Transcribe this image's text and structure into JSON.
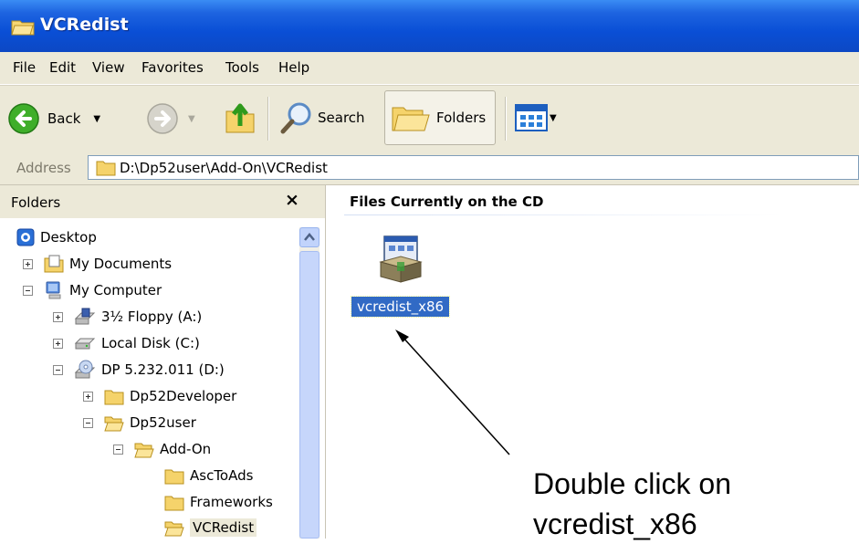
{
  "window": {
    "title": "VCRedist"
  },
  "menu": [
    {
      "label": "File"
    },
    {
      "label": "Edit"
    },
    {
      "label": "View"
    },
    {
      "label": "Favorites"
    },
    {
      "label": "Tools"
    },
    {
      "label": "Help"
    }
  ],
  "toolbar": {
    "back_label": "Back",
    "search_label": "Search",
    "folders_label": "Folders"
  },
  "address": {
    "label": "Address",
    "value": "D:\\Dp52user\\Add-On\\VCRedist"
  },
  "folders_pane": {
    "title": "Folders",
    "close": "×",
    "tree": [
      {
        "label": "Desktop"
      },
      {
        "label": "My Documents"
      },
      {
        "label": "My Computer"
      },
      {
        "label": "3½ Floppy (A:)"
      },
      {
        "label": "Local Disk (C:)"
      },
      {
        "label": "DP 5.232.011 (D:)"
      },
      {
        "label": "Dp52Developer"
      },
      {
        "label": "Dp52user"
      },
      {
        "label": "Add-On"
      },
      {
        "label": "AscToAds"
      },
      {
        "label": "Frameworks"
      },
      {
        "label": "VCRedist"
      }
    ]
  },
  "content": {
    "header": "Files Currently on the CD",
    "file_label": "vcredist_x86"
  },
  "annotation": {
    "line1": "Double click on",
    "line2": "vcredist_x86"
  },
  "colors": {
    "titlebar": "#0a4fd6",
    "chrome": "#ece9d8",
    "selection": "#316ac5",
    "folder": "#f5d36b"
  }
}
